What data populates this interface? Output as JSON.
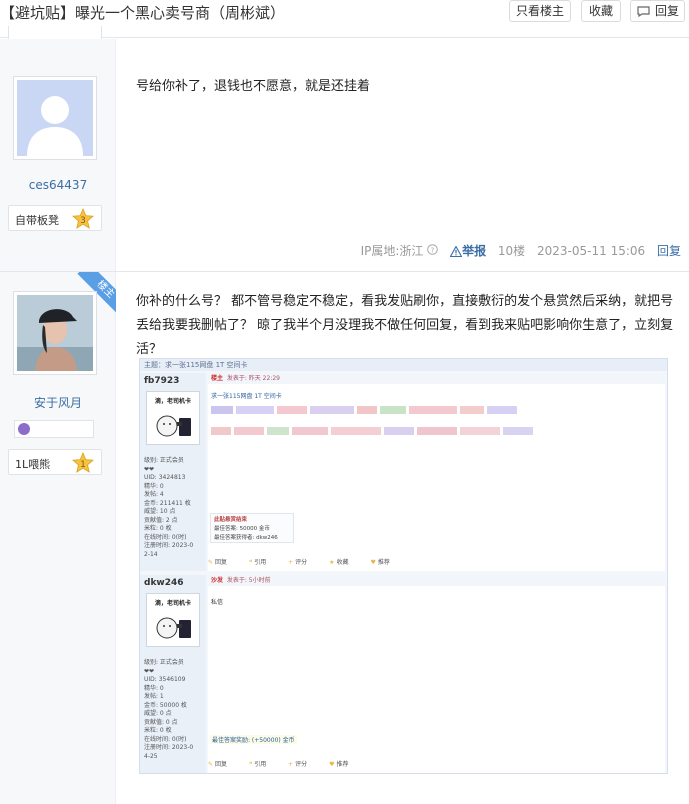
{
  "header": {
    "title": "【避坑贴】曝光一个黑心卖号商（周彬斌）",
    "buttons": {
      "only_op": "只看楼主",
      "favorite": "收藏",
      "reply": "回复"
    }
  },
  "post1": {
    "username": "ces64437",
    "badge_name": "自带板凳",
    "badge_level": "3",
    "content": "号给你补了，退钱也不愿意，就是还挂着",
    "meta": {
      "ip": "IP属地:浙江",
      "report": "举报",
      "floor": "10楼",
      "time": "2023-05-11 15:06",
      "reply": "回复"
    }
  },
  "post2": {
    "corner_label": "楼主",
    "username": "安于风月",
    "badge_name": "1L喂熊",
    "badge_level": "1",
    "content": "你补的什么号？ 都不管号稳定不稳定，看我发贴刷你，直接敷衍的发个悬赏然后采纳，就把号丢给我要我删帖了？ 晾了我半个月没理我不做任何回复，看到我来贴吧影响你生意了，立刻复活？"
  },
  "embedded": {
    "strip": "主题：求一张115网盘 1T 空间卡",
    "reply1": {
      "user": "fb7923",
      "pic_caption": "滴，老司机卡",
      "head_tag": "楼主",
      "head_time": "发表于: 昨天 22:29",
      "title": "求一张115网盘 1T 空间卡",
      "stats": "级别: 正式会员\n❤❤\nUID: 3424813\n精华: 0\n发帖: 4\n金币: 211411 枚\n威望: 10 点\n贡献值: 2 点\n米粒: 0 枚\n在线时间: 0(时)\n注册时间: 2023-0\n2-14",
      "reward_title": "此贴悬赏结束",
      "reward_amount": "最佳答案: 50000 金币",
      "reward_winner": "最佳答案获得者: dkw246"
    },
    "reply2": {
      "user": "dkw246",
      "pic_caption": "滴，老司机卡",
      "head_tag": "沙发",
      "head_time": "发表于: 5小时前",
      "message": "私信",
      "stats": "级别: 正式会员\n❤❤\nUID: 3546109\n精华: 0\n发帖: 1\n金币: 50000 枚\n威望: 0 点\n贡献值: 0 点\n米粒: 0 枚\n在线时间: 0(时)\n注册时间: 2023-0\n4-25",
      "score": "最佳答案奖励: (+50000) 金币"
    },
    "actions1": [
      "回复",
      "引用",
      "评分",
      "收藏",
      "推荐"
    ],
    "actions2": [
      "回复",
      "引用",
      "评分",
      "推荐"
    ]
  },
  "colors": {
    "link": "#3a6ea5",
    "corner": "#5a9fe6",
    "badge_gold": "#f5c242"
  }
}
